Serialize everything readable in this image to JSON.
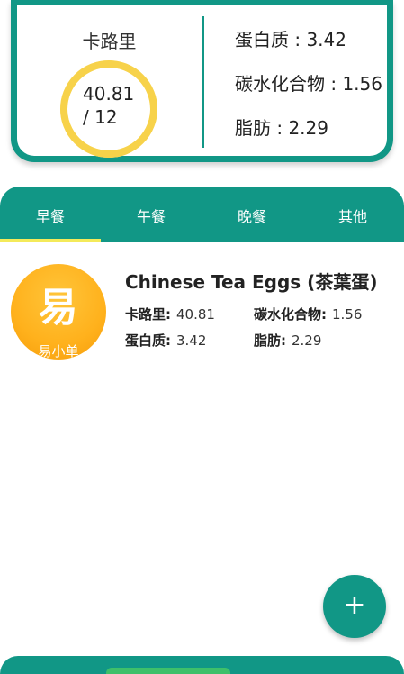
{
  "summary": {
    "calorie_label": "卡路里",
    "calorie_value": "40.81",
    "calorie_goal": "/ 12",
    "calorie_progress": 1.0,
    "macros": [
      {
        "label": "蛋白质 : 3.42"
      },
      {
        "label": "碳水化合物 : 1.56"
      },
      {
        "label": "脂肪 : 2.29"
      }
    ]
  },
  "tabs": [
    {
      "label": "早餐",
      "active": true
    },
    {
      "label": "午餐",
      "active": false
    },
    {
      "label": "晚餐",
      "active": false
    },
    {
      "label": "其他",
      "active": false
    }
  ],
  "food_items": [
    {
      "logo_glyph": "易",
      "logo_sub": "易小单",
      "name": "Chinese Tea Eggs (茶葉蛋)",
      "calories_label": "卡路里:",
      "calories": "40.81",
      "carbs_label": "碳水化合物:",
      "carbs": "1.56",
      "protein_label": "蛋白质:",
      "protein": "3.42",
      "fat_label": "脂肪:",
      "fat": "2.29"
    }
  ],
  "fab": {
    "icon": "plus-icon",
    "glyph": "+"
  },
  "colors": {
    "primary": "#119786",
    "ring": "#f7d24a",
    "ring_track": "#fbeaa5",
    "tab_indicator": "#f4ea5a",
    "logo": "#ffb11c"
  }
}
